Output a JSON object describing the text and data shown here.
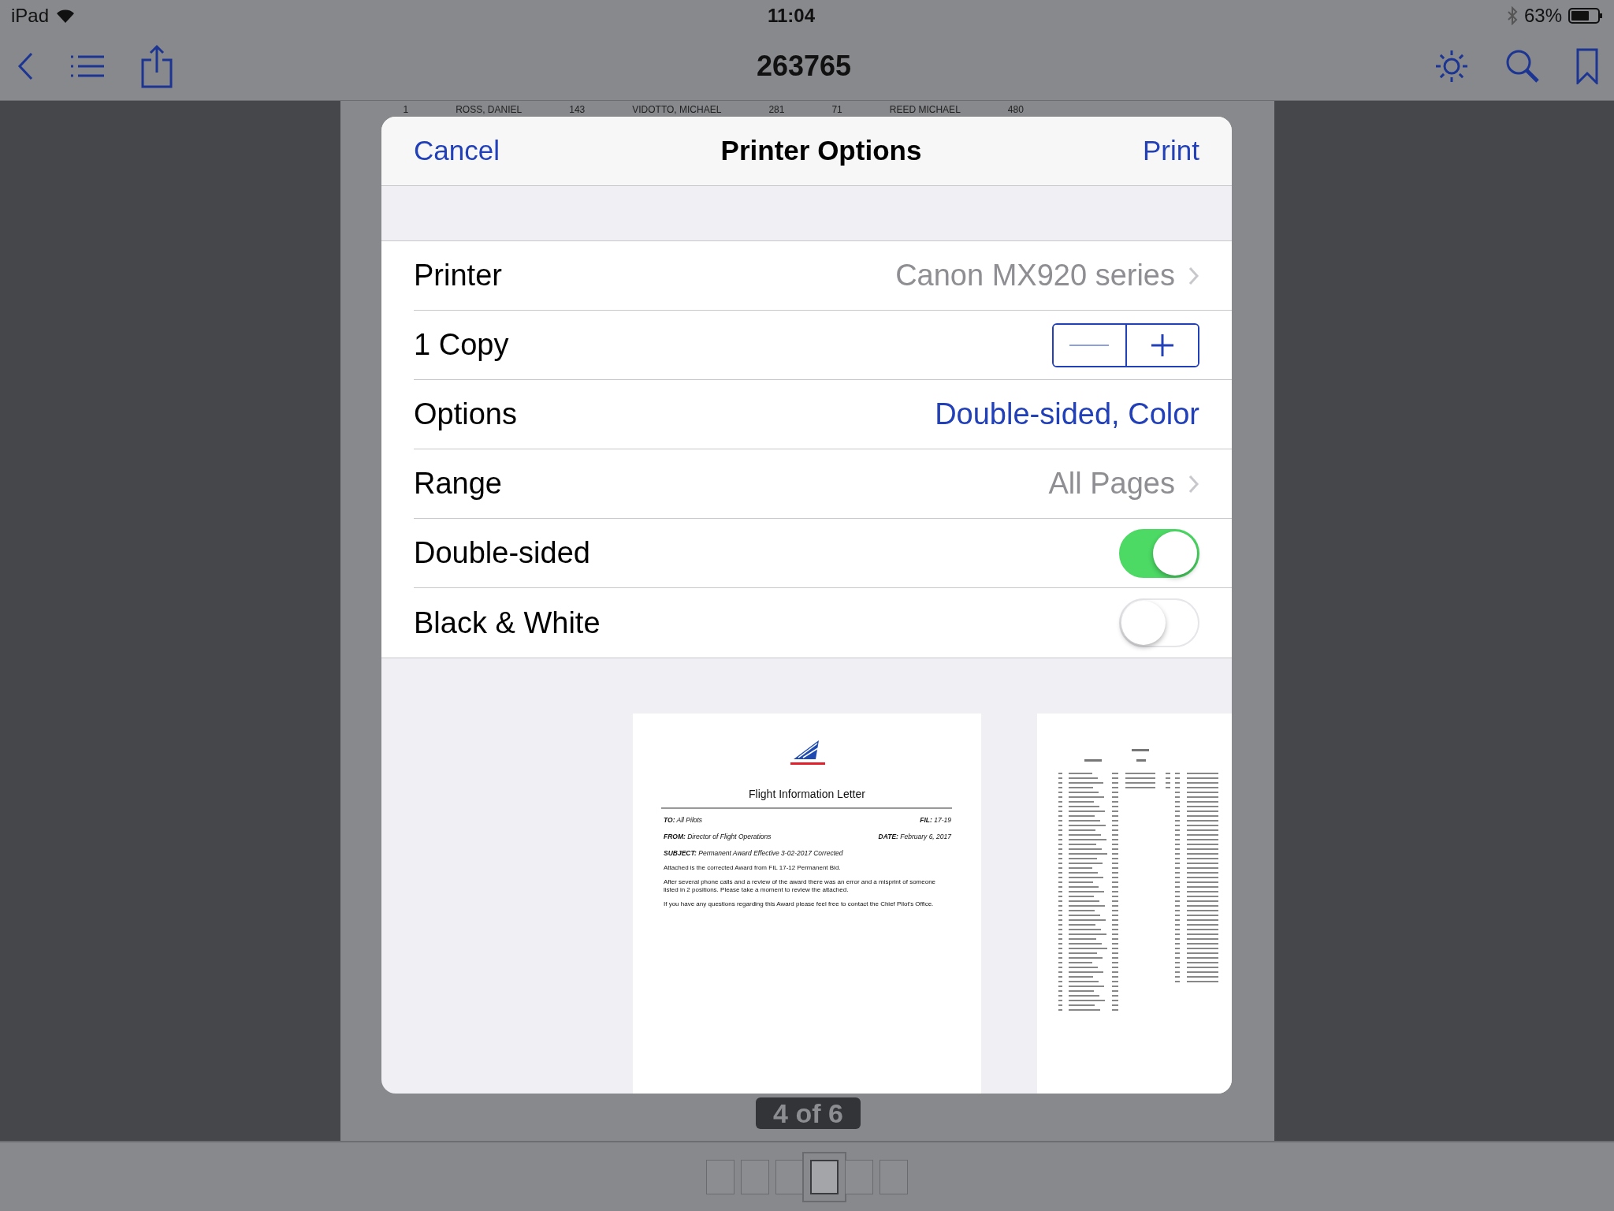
{
  "status_bar": {
    "device": "iPad",
    "time": "11:04",
    "battery": "63%"
  },
  "toolbar": {
    "title": "263765"
  },
  "background_document": {
    "texts": [
      "1",
      "ROSS, DANIEL",
      "143",
      "VIDOTTO, MICHAEL",
      "281",
      "71",
      "REED MICHAEL",
      "480"
    ]
  },
  "dialog": {
    "cancel": "Cancel",
    "title": "Printer Options",
    "print": "Print",
    "rows": [
      {
        "kind": "disclosure",
        "label": "Printer",
        "value": "Canon MX920 series"
      },
      {
        "kind": "stepper",
        "label": "1 Copy"
      },
      {
        "kind": "link",
        "label": "Options",
        "value": "Double-sided, Color"
      },
      {
        "kind": "disclosure",
        "label": "Range",
        "value": "All Pages"
      },
      {
        "kind": "toggle",
        "label": "Double-sided",
        "on": true
      },
      {
        "kind": "toggle",
        "label": "Black & White",
        "on": false
      }
    ],
    "preview_pages": [
      {
        "kind": "letter",
        "title": "Flight Information Letter",
        "header_rows": [
          [
            "**TO:**  All Pilots",
            "**FIL:** 17-19"
          ],
          [
            "**FROM:** Director of Flight Operations",
            "**DATE:** February 6, 2017"
          ],
          [
            "**SUBJECT:**    Permanent Award Effective 3-02-2017 Corrected"
          ]
        ],
        "paragraphs": [
          "Attached is the corrected Award from FIL 17-12 Permanent Bid.",
          "After several phone calls and a review of the award there was an error and a misprint of someone listed in 2 positions. Please take a moment to review the attached.",
          "If you have any questions regarding this Award please feel free to contact the Chief Pilot's Office."
        ]
      },
      {
        "kind": "list"
      }
    ]
  },
  "page_indicator": "4 of 6",
  "thumbnails": [
    {
      "selected": false
    },
    {
      "selected": false
    },
    {
      "selected": false
    },
    {
      "selected": true
    },
    {
      "selected": false
    },
    {
      "selected": false
    }
  ]
}
